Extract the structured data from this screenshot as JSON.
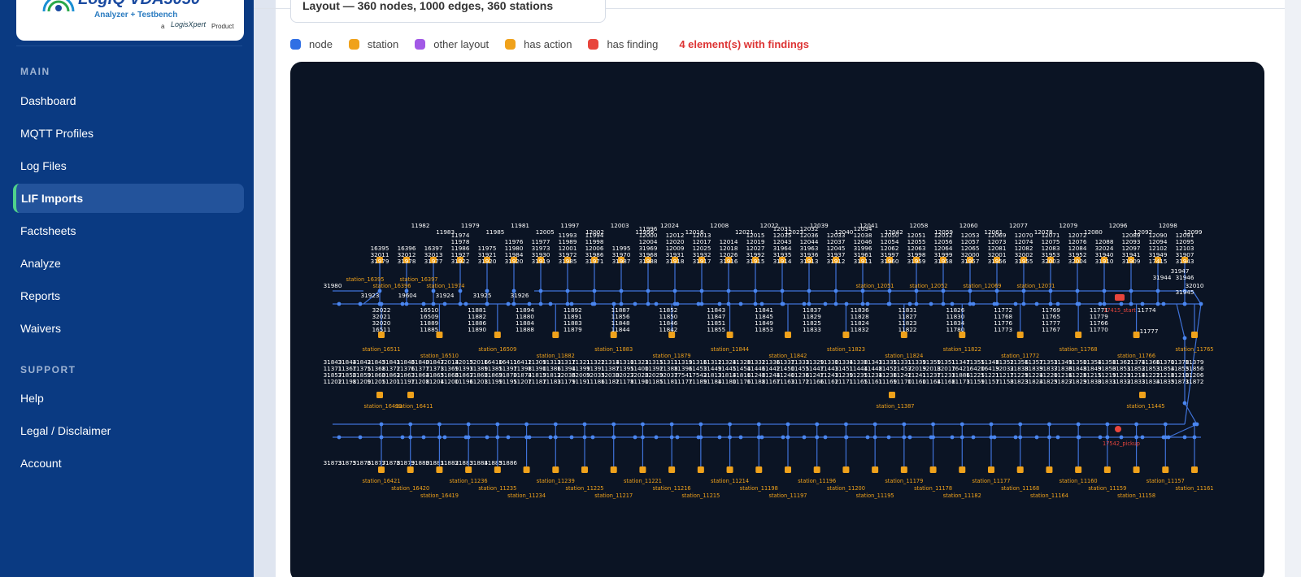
{
  "brand": {
    "title": "LogiQ VDA5050",
    "subtitle": "Analyzer + Testbench",
    "a": "a",
    "company": "LogisXpert",
    "product": "Product"
  },
  "sidebar": {
    "main_label": "MAIN",
    "main_items": [
      "Dashboard",
      "MQTT Profiles",
      "Log Files",
      "LIF Imports",
      "Factsheets",
      "Analyze",
      "Reports",
      "Waivers"
    ],
    "active_item": "LIF Imports",
    "support_label": "SUPPORT",
    "support_items": [
      "Help",
      "Legal / Disclaimer",
      "Account"
    ]
  },
  "layout_summary": "Layout — 360 nodes, 1000 edges, 360 stations",
  "legend": {
    "items": [
      {
        "label": "node",
        "color": "#2f6fe4"
      },
      {
        "label": "station",
        "color": "#f0a21b"
      },
      {
        "label": "other layout",
        "color": "#a259e6"
      },
      {
        "label": "has action",
        "color": "#f0a21b"
      },
      {
        "label": "has finding",
        "color": "#e8453c"
      }
    ],
    "findings_text": "4 element(s) with findings"
  },
  "colors": {
    "sidebar_bg": "#0a3a82",
    "canvas_bg": "#0b1424",
    "edge": "#3f72d8",
    "node": "#4a86f0",
    "station": "#f0a21b",
    "node_label": "#ffffff",
    "station_label": "#f0a21b",
    "finding": "#e8453c"
  },
  "graph": {
    "top_rows": [
      {
        "labels": [
          "16395",
          "32011",
          "31979"
        ],
        "station": "station_16395"
      },
      {
        "labels": [
          "16396",
          "32012",
          "31978"
        ],
        "station": "station_16396"
      },
      {
        "labels": [
          "16397",
          "32013",
          "31977"
        ],
        "station": "station_16397"
      },
      {
        "labels": [
          "11974",
          "11978",
          "11986",
          "11927",
          "31922"
        ],
        "station": "station_11974"
      },
      {
        "labels": [
          "11975",
          "31921",
          "31920"
        ],
        "station": ""
      },
      {
        "labels": [
          "11976",
          "11980",
          "11984",
          "31920"
        ],
        "station": ""
      },
      {
        "labels": [
          "11977",
          "31973",
          "31930",
          "31919"
        ],
        "station": ""
      },
      {
        "labels": [
          "11993",
          "11989",
          "12001",
          "31972",
          "31985"
        ],
        "station": ""
      },
      {
        "labels": [
          "11994",
          "11998",
          "12006",
          "31986",
          "31971"
        ],
        "station": ""
      },
      {
        "labels": [
          "11995",
          "31970",
          "31987"
        ],
        "station": ""
      },
      {
        "labels": [
          "11996",
          "12000",
          "12004",
          "31969",
          "31968",
          "31988"
        ],
        "station": ""
      },
      {
        "labels": [
          "12012",
          "12020",
          "12009",
          "31931",
          "31918"
        ],
        "station": ""
      },
      {
        "labels": [
          "12013",
          "12017",
          "12025",
          "31932",
          "31917"
        ],
        "station": ""
      },
      {
        "labels": [
          "12014",
          "12018",
          "12026",
          "31916"
        ],
        "station": ""
      },
      {
        "labels": [
          "12015",
          "12019",
          "12027",
          "31992",
          "31915"
        ],
        "station": ""
      },
      {
        "labels": [
          "12031",
          "12035",
          "12043",
          "31964",
          "31935",
          "31914"
        ],
        "station": ""
      },
      {
        "labels": [
          "12032",
          "12036",
          "12044",
          "31963",
          "31936",
          "31913"
        ],
        "station": ""
      },
      {
        "labels": [
          "12033",
          "12037",
          "12045",
          "31937",
          "31912"
        ],
        "station": ""
      },
      {
        "labels": [
          "12034",
          "12038",
          "12046",
          "31996",
          "31961",
          "31911"
        ],
        "station": ""
      },
      {
        "labels": [
          "12050",
          "12054",
          "12062",
          "31997",
          "31960"
        ],
        "station": "station_12051"
      },
      {
        "labels": [
          "12051",
          "12055",
          "12063",
          "31998",
          "31959"
        ],
        "station": ""
      },
      {
        "labels": [
          "12052",
          "12056",
          "12064",
          "31999",
          "31958"
        ],
        "station": "station_12052"
      },
      {
        "labels": [
          "12053",
          "12057",
          "12065",
          "32000",
          "31957"
        ],
        "station": ""
      },
      {
        "labels": [
          "12069",
          "12073",
          "12081",
          "32001",
          "31956"
        ],
        "station": "station_12069"
      },
      {
        "labels": [
          "12070",
          "12074",
          "12082",
          "32002",
          "31955"
        ],
        "station": ""
      },
      {
        "labels": [
          "12071",
          "12075",
          "12083",
          "31953",
          "32003"
        ],
        "station": "station_12071"
      },
      {
        "labels": [
          "12072",
          "12076",
          "12084",
          "31952",
          "32004"
        ],
        "station": ""
      },
      {
        "labels": [
          "12088",
          "32024",
          "31940",
          "31910"
        ],
        "station": ""
      },
      {
        "labels": [
          "12089",
          "12093",
          "12097",
          "31941",
          "31909"
        ],
        "station": ""
      },
      {
        "labels": [
          "12090",
          "12094",
          "12102",
          "31949",
          "17415"
        ],
        "station": ""
      },
      {
        "labels": [
          "12091",
          "12095",
          "12103",
          "31907",
          "31943"
        ],
        "station": ""
      }
    ],
    "top_headers": [
      "11982",
      "11983",
      "11979",
      "11985",
      "11981",
      "12005",
      "11997",
      "12002",
      "12003",
      "11999",
      "12024",
      "12016",
      "12008",
      "12021",
      "12022",
      "12023",
      "12039",
      "12040",
      "12041",
      "12042",
      "12058",
      "12059",
      "12060",
      "12061",
      "12077",
      "12078",
      "12079",
      "12080",
      "12096",
      "12092",
      "12098",
      "12099"
    ],
    "top_row_y_labels": [
      "31980",
      "31923",
      "19604",
      "31924",
      "31925",
      "31926"
    ],
    "mid_stations": [
      "station_16511",
      "station_16510",
      "station_16509",
      "station_11882",
      "station_11883",
      "station_11879",
      "station_11844",
      "station_11842",
      "station_11823",
      "station_11824",
      "station_11822",
      "station_11772",
      "station_11768",
      "station_11766",
      "station_11765"
    ],
    "mid_labels": [
      "32022",
      "32021",
      "32020",
      "16511",
      "16510",
      "16509",
      "11889",
      "11885",
      "11881",
      "11882",
      "11886",
      "11890",
      "11894",
      "11880",
      "11884",
      "11888",
      "11892",
      "11891",
      "11883",
      "11879",
      "11887",
      "11856",
      "11848",
      "11844",
      "11852",
      "11850",
      "11846",
      "11842",
      "11843",
      "11847",
      "11851",
      "11855",
      "11841",
      "11845",
      "11849",
      "11853",
      "11837",
      "11829",
      "11825",
      "11833",
      "11836",
      "11828",
      "11824",
      "11832",
      "11831",
      "11827",
      "11823",
      "11822",
      "11826",
      "11830",
      "11834",
      "11780",
      "11772",
      "11768",
      "11776",
      "11773",
      "11769",
      "11765",
      "11777",
      "11767",
      "11771",
      "11779",
      "11766",
      "11770",
      "11774"
    ],
    "bottom_stations": [
      "station_16421",
      "station_16420",
      "station_16419",
      "station_11236",
      "station_11235",
      "station_11234",
      "station_11239",
      "station_11225",
      "station_11217",
      "station_11221",
      "station_11216",
      "station_11215",
      "station_11214",
      "station_11198",
      "station_11197",
      "station_11196",
      "station_11200",
      "station_11195",
      "station_11179",
      "station_11178",
      "station_11182",
      "station_11177",
      "station_11168",
      "station_11164",
      "station_11160",
      "station_11159",
      "station_11158",
      "station_11157",
      "station_11161"
    ],
    "bottom_mid_stations": [
      "station_16410",
      "station_16411",
      "station_11387",
      "station_11445"
    ],
    "bottom_labels": [
      "31843",
      "31844",
      "31842",
      "31845",
      "31841",
      "31846",
      "31840",
      "31847",
      "32014",
      "32015",
      "32016",
      "16410",
      "16411",
      "16412",
      "11309",
      "11313",
      "11317",
      "11321",
      "11322",
      "11314",
      "11310",
      "11323",
      "11315",
      "11311",
      "11319",
      "11316",
      "11312",
      "11324",
      "11328",
      "11332",
      "11336",
      "11337",
      "11333",
      "11329",
      "11330",
      "11334",
      "11338",
      "11343",
      "11335",
      "11331",
      "11339",
      "11359",
      "11351",
      "11347",
      "11355",
      "11348",
      "11352",
      "11356",
      "11357",
      "11353",
      "11349",
      "11350",
      "11354",
      "11358",
      "11362",
      "11374",
      "11366",
      "11370",
      "11378",
      "11379",
      "11371",
      "11367",
      "11375",
      "11368",
      "11372",
      "11376",
      "11377",
      "11373",
      "11369",
      "11393",
      "11389",
      "11385",
      "11397",
      "11398",
      "11390",
      "11386",
      "11394",
      "11399",
      "11391",
      "11387",
      "11395",
      "11400",
      "11392",
      "11388",
      "11396",
      "11453",
      "11449",
      "11445",
      "11454",
      "11446",
      "11442",
      "11450",
      "11455",
      "11447",
      "11443",
      "11451",
      "11444",
      "11448",
      "11452",
      "11457",
      "32019",
      "32018",
      "32017",
      "16421",
      "16420",
      "16419",
      "32032",
      "31838",
      "31839",
      "31837",
      "31836",
      "31848",
      "31849",
      "31850",
      "31851",
      "31852",
      "31853",
      "31854",
      "31855",
      "31856",
      "31857",
      "31858",
      "31859",
      "31860",
      "31862",
      "31863",
      "31864",
      "31865",
      "31866",
      "31867",
      "31868",
      "31869",
      "31870",
      "31874",
      "31819",
      "31812",
      "32036",
      "32009",
      "32035",
      "32030",
      "32027",
      "32028",
      "32029",
      "32037",
      "17541",
      "17542",
      "31813",
      "31814",
      "31816",
      "11248",
      "11244",
      "11240",
      "11236",
      "11247",
      "11243",
      "11239",
      "11235",
      "11234",
      "11238",
      "11242",
      "11241",
      "11237",
      "11233",
      "11886",
      "11225",
      "11221",
      "11217",
      "11229",
      "11224",
      "11220",
      "11216",
      "11228",
      "11215",
      "11219",
      "11223",
      "11214",
      "11222",
      "11218",
      "11210",
      "11206",
      "11202",
      "11198",
      "11209",
      "11205",
      "11201",
      "11197",
      "11208",
      "11204",
      "11200",
      "11196",
      "11203",
      "11199",
      "11195",
      "11207",
      "11187",
      "11183",
      "11179",
      "11191",
      "11186",
      "11182",
      "11178",
      "11190",
      "11185",
      "11181",
      "11177",
      "11189",
      "11184",
      "11180",
      "11176",
      "11188",
      "11167",
      "11163",
      "11172",
      "11166",
      "11162",
      "11171",
      "11165",
      "11161",
      "11169",
      "11170",
      "11160",
      "11164",
      "11168",
      "11173",
      "11159",
      "11157",
      "11158",
      "31823",
      "31824",
      "31825",
      "31827",
      "31829",
      "31830",
      "31831",
      "31832",
      "31833",
      "31834",
      "31835",
      "31871",
      "31872",
      "31873",
      "31875",
      "31876",
      "31877",
      "31878",
      "31879",
      "31880",
      "31881",
      "31882",
      "31883",
      "31884",
      "31885",
      "31886"
    ],
    "finding_labels": [
      "17415_start",
      "17542_pickup"
    ],
    "far_right_labels": [
      "31947",
      "31946",
      "31944",
      "31945",
      "32010",
      "11777"
    ]
  }
}
